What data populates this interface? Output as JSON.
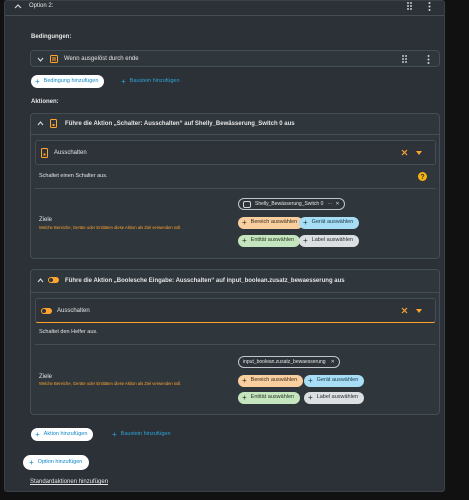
{
  "option": {
    "title": "Option 2:"
  },
  "conditions": {
    "heading": "Bedingungen:",
    "item_label": "Wenn ausgelöst durch ende",
    "add_condition": "Bedingung hinzufügen",
    "add_block": "Baustein hinzufügen"
  },
  "actions": {
    "heading": "Aktionen:",
    "action1": {
      "title": "Führe die Aktion „Schalter: Ausschalten“ auf Shelly_Bewässerung_Switch 0 aus",
      "service": "Ausschalten",
      "description": "Schaltet einen Schalter aus.",
      "targets_label": "Ziele",
      "targets_hint": "Welche Bereiche, Geräte oder Entitäten diese Aktion als Ziel verwenden soll.",
      "chip": "Shelly_Bewässerung_Switch 0",
      "btn_area": "Bereich auswählen",
      "btn_device": "Gerät auswählen",
      "btn_entity": "Entität auswählen",
      "btn_label": "Label auswählen"
    },
    "action2": {
      "title": "Führe die Aktion „Boolesche Eingabe: Ausschalten“ auf input_boolean.zusatz_bewaesserung aus",
      "service": "Ausschalten",
      "description": "Schaltet den Helfer aus.",
      "targets_label": "Ziele",
      "targets_hint": "Welche Bereiche, Geräte oder Entitäten diese Aktion als Ziel verwenden soll.",
      "chip": "input_boolean.zusatz_bewaesserung",
      "btn_area": "Bereich auswählen",
      "btn_device": "Gerät auswählen",
      "btn_entity": "Entität auswählen",
      "btn_label": "Label auswählen"
    },
    "add_action": "Aktion hinzufügen",
    "add_block": "Baustein hinzufügen"
  },
  "footer": {
    "add_option": "Option hinzufügen",
    "default_actions": "Standardaktionen hinzufügen"
  },
  "colors": {
    "accent_blue": "#0f87c7",
    "warning_orange": "#ffa42e",
    "help_yellow": "#f5b30e",
    "card_bg": "#2f363c"
  },
  "icons": [
    "chevron-up-icon",
    "chevron-down-icon",
    "drag-handle-icon",
    "more-vert-icon",
    "trigger-icon",
    "plus-icon",
    "switch-icon",
    "toggle-icon",
    "close-icon",
    "help-icon"
  ]
}
